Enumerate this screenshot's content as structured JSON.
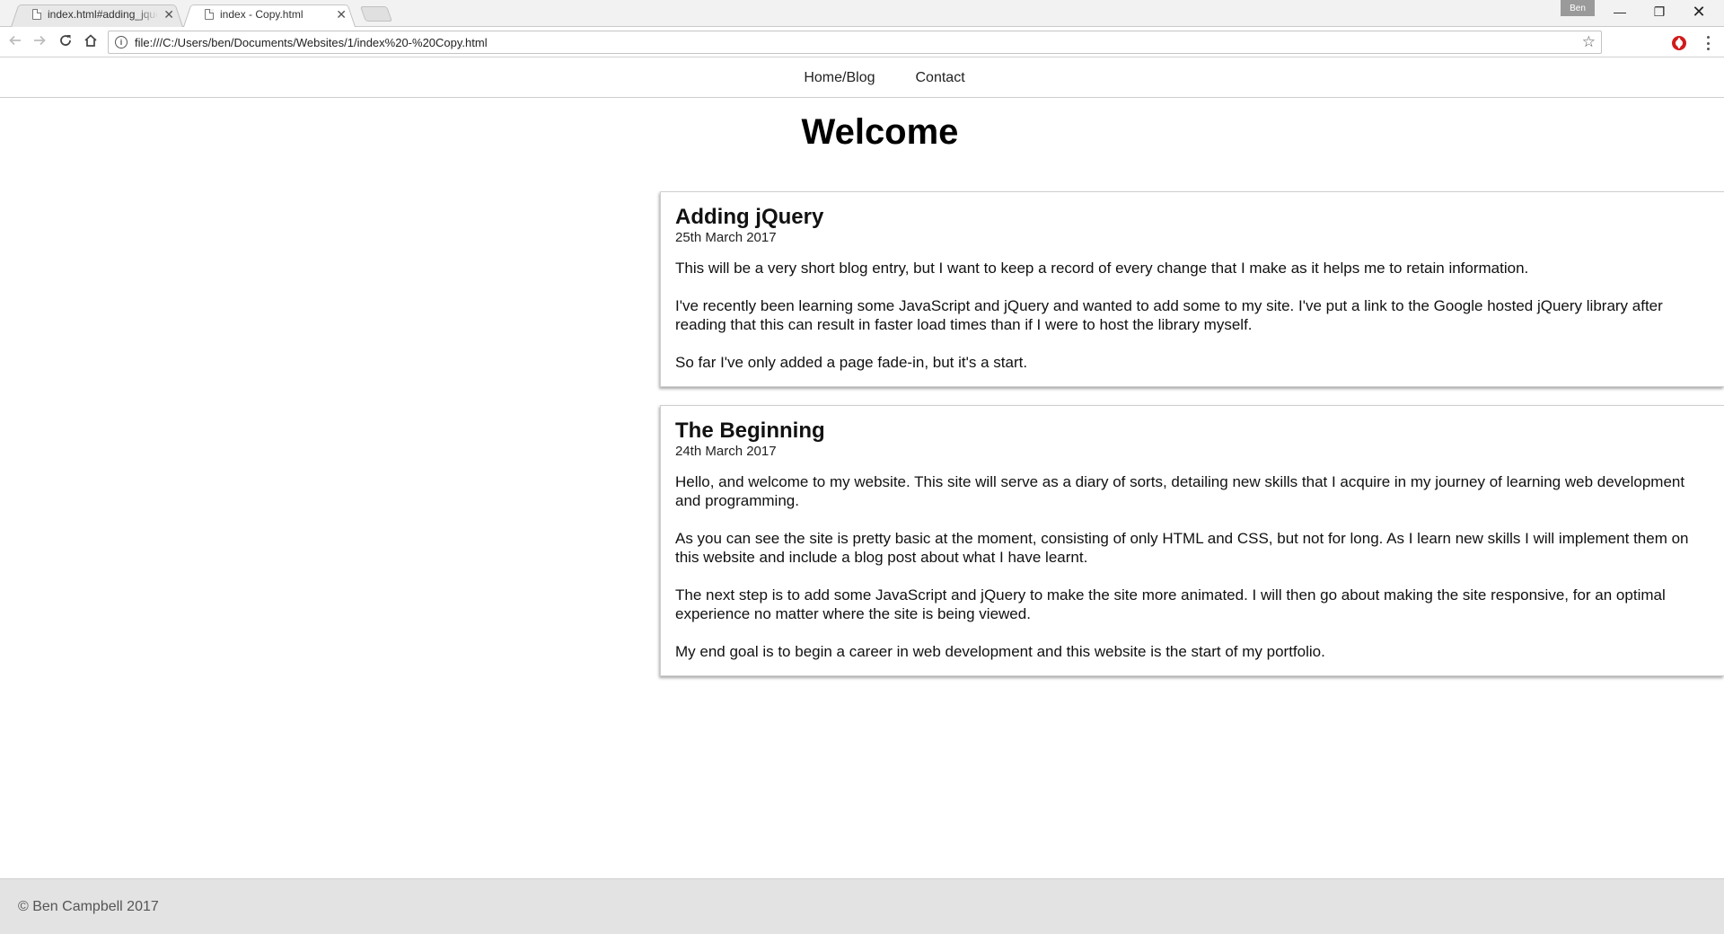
{
  "browser": {
    "tabs": [
      {
        "title": "index.html#adding_jquery",
        "close": "✕"
      },
      {
        "title": "index - Copy.html",
        "close": "✕"
      }
    ],
    "profile_name": "Ben",
    "window_controls": {
      "minimize": "—",
      "maximize": "❐",
      "close": "✕"
    },
    "address_url": "file:///C:/Users/ben/Documents/Websites/1/index%20-%20Copy.html",
    "icons": {
      "back": "arrow-left-icon",
      "forward": "arrow-right-icon",
      "reload": "reload-icon",
      "home": "home-icon",
      "info": "info-icon",
      "bookmark": "star-icon",
      "extension": "opera-icon",
      "menu": "menu-dots-icon"
    }
  },
  "site": {
    "nav": [
      {
        "label": "Home/Blog"
      },
      {
        "label": "Contact"
      }
    ],
    "heading": "Welcome",
    "posts": [
      {
        "title": "Adding jQuery",
        "date": "25th March 2017",
        "paragraphs": [
          "This will be a very short blog entry, but I want to keep a record of every change that I make as it helps me to retain information.",
          "I've recently been learning some JavaScript and jQuery and wanted to add some to my site. I've put a link to the Google hosted jQuery library after reading that this can result in faster load times than if I were to host the library myself.",
          "So far I've only added a page fade-in, but it's a start."
        ]
      },
      {
        "title": "The Beginning",
        "date": "24th March 2017",
        "paragraphs": [
          "Hello, and welcome to my website. This site will serve as a diary of sorts, detailing new skills that I acquire in my journey of learning web development and programming.",
          "As you can see the site is pretty basic at the moment, consisting of only HTML and CSS, but not for long. As I learn new skills I will implement them on this website and include a blog post about what I have learnt.",
          "The next step is to add some JavaScript and jQuery to make the site more animated. I will then go about making the site responsive, for an optimal experience no matter where the site is being viewed.",
          "My end goal is to begin a career in web development and this website is the start of my portfolio."
        ]
      }
    ],
    "footer": "© Ben Campbell 2017"
  }
}
